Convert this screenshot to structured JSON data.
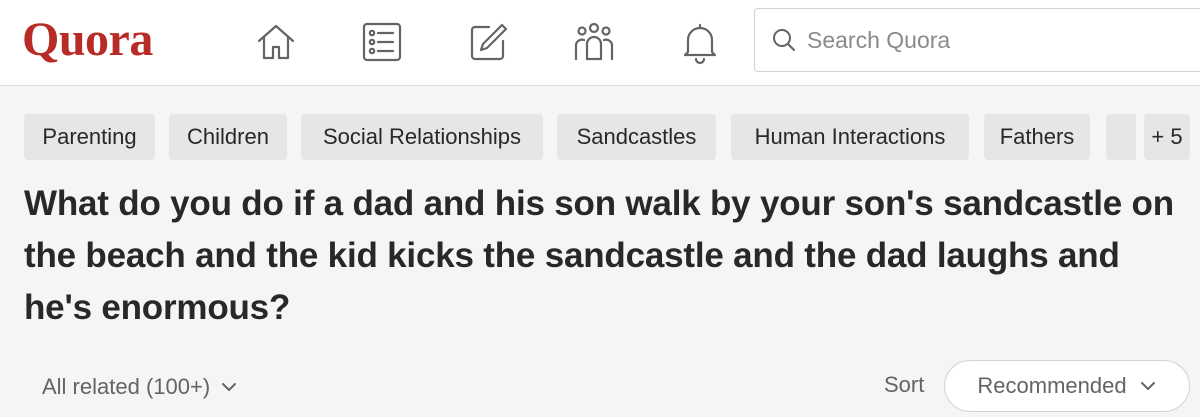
{
  "header": {
    "logo": "Quora",
    "nav_icons": [
      "home-icon",
      "following-list-icon",
      "answer-edit-icon",
      "spaces-people-icon",
      "notifications-bell-icon"
    ],
    "search_placeholder": "Search Quora"
  },
  "topics": {
    "chips": [
      "Parenting",
      "Children",
      "Social Relationships",
      "Sandcastles",
      "Human Interactions",
      "Fathers"
    ],
    "more_label": "+ 5"
  },
  "question": {
    "title": "What do you do if a dad and his son walk by your son's sandcastle on the beach and the kid kicks the sandcastle and the dad laughs and he's enormous?"
  },
  "answers_bar": {
    "all_related_label": "All related (100+)",
    "sort_label": "Sort",
    "sort_value": "Recommended"
  },
  "colors": {
    "brand": "#b92b27",
    "background": "#f5f5f5",
    "chip_bg": "#e6e6e6",
    "text": "#282829",
    "muted": "#636466"
  }
}
